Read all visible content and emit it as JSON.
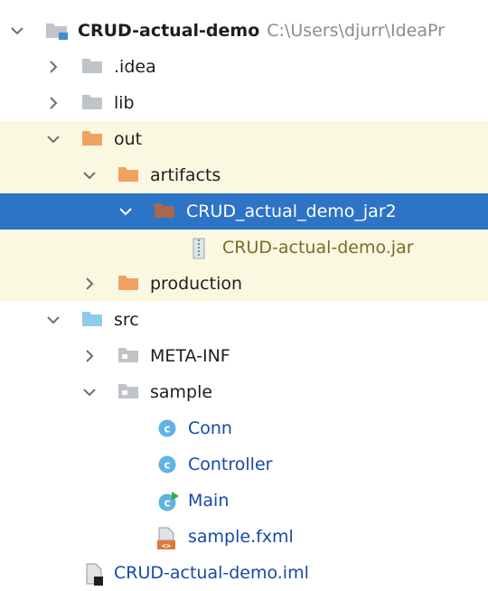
{
  "project": {
    "name": "CRUD-actual-demo",
    "path": "C:\\Users\\djurr\\IdeaPr"
  },
  "items": [
    {
      "label": ".idea"
    },
    {
      "label": "lib"
    },
    {
      "label": "out"
    },
    {
      "label": "artifacts"
    },
    {
      "label": "CRUD_actual_demo_jar2"
    },
    {
      "label": "CRUD-actual-demo.jar"
    },
    {
      "label": "production"
    },
    {
      "label": "src"
    },
    {
      "label": "META-INF"
    },
    {
      "label": "sample"
    },
    {
      "label": "Conn"
    },
    {
      "label": "Controller"
    },
    {
      "label": "Main"
    },
    {
      "label": "sample.fxml"
    },
    {
      "label": "CRUD-actual-demo.iml"
    }
  ],
  "colors": {
    "selection": "#2d73c6",
    "excluded_bg": "#fbf8e1",
    "folder_gray": "#bfc4c9",
    "folder_orange": "#f0a162",
    "folder_blue": "#8ecbeb",
    "class_icon": "#5fb4e4",
    "link_blue": "#1848a8"
  }
}
